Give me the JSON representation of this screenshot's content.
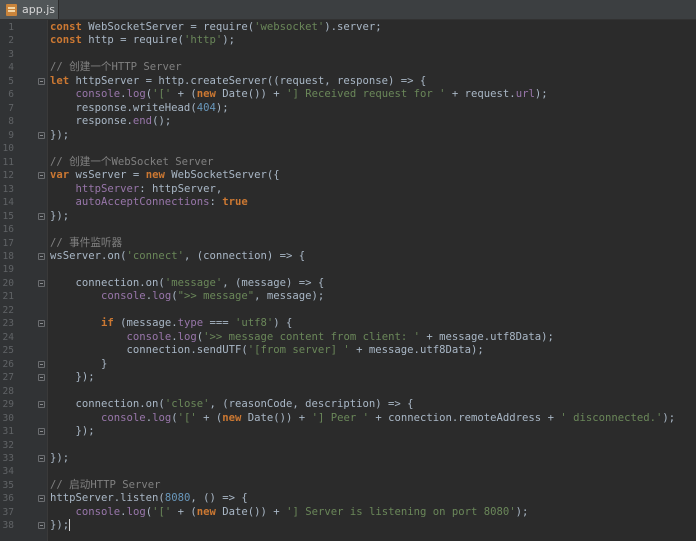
{
  "tab": {
    "label": "app.js",
    "icon": "js-file-icon"
  },
  "colors": {
    "background": "#2b2b2b",
    "keyword": "#cc7832",
    "string": "#6a8759",
    "number": "#6897bb",
    "property": "#9876aa",
    "comment": "#808080",
    "default": "#a9b7c6"
  },
  "code": {
    "lines": [
      {
        "n": "1",
        "tokens": [
          [
            "kw",
            "const"
          ],
          [
            "def",
            " WebSocketServer = require("
          ],
          [
            "str",
            "'websocket'"
          ],
          [
            "def",
            ").server;"
          ]
        ]
      },
      {
        "n": "2",
        "tokens": [
          [
            "kw",
            "const"
          ],
          [
            "def",
            " http = require("
          ],
          [
            "str",
            "'http'"
          ],
          [
            "def",
            ");"
          ]
        ]
      },
      {
        "n": "3",
        "tokens": []
      },
      {
        "n": "4",
        "tokens": [
          [
            "com",
            "// 创建一个HTTP Server"
          ]
        ]
      },
      {
        "n": "5",
        "fold": true,
        "tokens": [
          [
            "kw",
            "let"
          ],
          [
            "def",
            " httpServer = http.createServer((request, response) => {"
          ]
        ]
      },
      {
        "n": "6",
        "tokens": [
          [
            "def",
            "    "
          ],
          [
            "prop",
            "console"
          ],
          [
            "def",
            "."
          ],
          [
            "prop",
            "log"
          ],
          [
            "def",
            "("
          ],
          [
            "str",
            "'['"
          ],
          [
            "def",
            " + ("
          ],
          [
            "kw",
            "new"
          ],
          [
            "def",
            " Date()) + "
          ],
          [
            "str",
            "'] Received request for '"
          ],
          [
            "def",
            " + request."
          ],
          [
            "prop",
            "url"
          ],
          [
            "def",
            ");"
          ]
        ]
      },
      {
        "n": "7",
        "tokens": [
          [
            "def",
            "    response.writeHead("
          ],
          [
            "num",
            "404"
          ],
          [
            "def",
            ");"
          ]
        ]
      },
      {
        "n": "8",
        "tokens": [
          [
            "def",
            "    response."
          ],
          [
            "prop",
            "end"
          ],
          [
            "def",
            "();"
          ]
        ]
      },
      {
        "n": "9",
        "fold": true,
        "tokens": [
          [
            "def",
            "});"
          ]
        ]
      },
      {
        "n": "10",
        "tokens": []
      },
      {
        "n": "11",
        "tokens": [
          [
            "com",
            "// 创建一个WebSocket Server"
          ]
        ]
      },
      {
        "n": "12",
        "fold": true,
        "tokens": [
          [
            "kw",
            "var"
          ],
          [
            "def",
            " wsServer = "
          ],
          [
            "kw",
            "new"
          ],
          [
            "def",
            " WebSocketServer({"
          ]
        ]
      },
      {
        "n": "13",
        "tokens": [
          [
            "def",
            "    "
          ],
          [
            "prop",
            "httpServer"
          ],
          [
            "def",
            ": httpServer,"
          ]
        ]
      },
      {
        "n": "14",
        "tokens": [
          [
            "def",
            "    "
          ],
          [
            "prop",
            "autoAcceptConnections"
          ],
          [
            "def",
            ": "
          ],
          [
            "kw",
            "true"
          ]
        ]
      },
      {
        "n": "15",
        "fold": true,
        "tokens": [
          [
            "def",
            "});"
          ]
        ]
      },
      {
        "n": "16",
        "tokens": []
      },
      {
        "n": "17",
        "tokens": [
          [
            "com",
            "// 事件监听器"
          ]
        ]
      },
      {
        "n": "18",
        "fold": true,
        "tokens": [
          [
            "def",
            "wsServer.on("
          ],
          [
            "str",
            "'connect'"
          ],
          [
            "def",
            ", (connection) => {"
          ]
        ]
      },
      {
        "n": "19",
        "tokens": []
      },
      {
        "n": "20",
        "fold": true,
        "tokens": [
          [
            "def",
            "    connection.on("
          ],
          [
            "str",
            "'message'"
          ],
          [
            "def",
            ", (message) => {"
          ]
        ]
      },
      {
        "n": "21",
        "tokens": [
          [
            "def",
            "        "
          ],
          [
            "prop",
            "console"
          ],
          [
            "def",
            "."
          ],
          [
            "prop",
            "log"
          ],
          [
            "def",
            "("
          ],
          [
            "str",
            "\">> message\""
          ],
          [
            "def",
            ", message);"
          ]
        ]
      },
      {
        "n": "22",
        "tokens": []
      },
      {
        "n": "23",
        "fold": true,
        "tokens": [
          [
            "def",
            "        "
          ],
          [
            "kw",
            "if"
          ],
          [
            "def",
            " (message."
          ],
          [
            "prop",
            "type"
          ],
          [
            "def",
            " === "
          ],
          [
            "str",
            "'utf8'"
          ],
          [
            "def",
            ") {"
          ]
        ]
      },
      {
        "n": "24",
        "tokens": [
          [
            "def",
            "            "
          ],
          [
            "prop",
            "console"
          ],
          [
            "def",
            "."
          ],
          [
            "prop",
            "log"
          ],
          [
            "def",
            "("
          ],
          [
            "str",
            "'>> message content from client: '"
          ],
          [
            "def",
            " + message.utf8Data);"
          ]
        ]
      },
      {
        "n": "25",
        "tokens": [
          [
            "def",
            "            connection.sendUTF("
          ],
          [
            "str",
            "'[from server] '"
          ],
          [
            "def",
            " + message.utf8Data);"
          ]
        ]
      },
      {
        "n": "26",
        "fold": true,
        "tokens": [
          [
            "def",
            "        }"
          ]
        ]
      },
      {
        "n": "27",
        "fold": true,
        "tokens": [
          [
            "def",
            "    });"
          ]
        ]
      },
      {
        "n": "28",
        "tokens": []
      },
      {
        "n": "29",
        "fold": true,
        "tokens": [
          [
            "def",
            "    connection.on("
          ],
          [
            "str",
            "'close'"
          ],
          [
            "def",
            ", (reasonCode, description) => {"
          ]
        ]
      },
      {
        "n": "30",
        "tokens": [
          [
            "def",
            "        "
          ],
          [
            "prop",
            "console"
          ],
          [
            "def",
            "."
          ],
          [
            "prop",
            "log"
          ],
          [
            "def",
            "("
          ],
          [
            "str",
            "'['"
          ],
          [
            "def",
            " + ("
          ],
          [
            "kw",
            "new"
          ],
          [
            "def",
            " Date()) + "
          ],
          [
            "str",
            "'] Peer '"
          ],
          [
            "def",
            " + connection.remoteAddress + "
          ],
          [
            "str",
            "' disconnected.'"
          ],
          [
            "def",
            ");"
          ]
        ]
      },
      {
        "n": "31",
        "fold": true,
        "tokens": [
          [
            "def",
            "    });"
          ]
        ]
      },
      {
        "n": "32",
        "tokens": []
      },
      {
        "n": "33",
        "fold": true,
        "tokens": [
          [
            "def",
            "});"
          ]
        ]
      },
      {
        "n": "34",
        "tokens": []
      },
      {
        "n": "35",
        "tokens": [
          [
            "com",
            "// 启动HTTP Server"
          ]
        ]
      },
      {
        "n": "36",
        "fold": true,
        "tokens": [
          [
            "def",
            "httpServer.listen("
          ],
          [
            "num",
            "8080"
          ],
          [
            "def",
            ", () => {"
          ]
        ]
      },
      {
        "n": "37",
        "tokens": [
          [
            "def",
            "    "
          ],
          [
            "prop",
            "console"
          ],
          [
            "def",
            "."
          ],
          [
            "prop",
            "log"
          ],
          [
            "def",
            "("
          ],
          [
            "str",
            "'['"
          ],
          [
            "def",
            " + ("
          ],
          [
            "kw",
            "new"
          ],
          [
            "def",
            " Date()) + "
          ],
          [
            "str",
            "'] Server is listening on port 8080'"
          ],
          [
            "def",
            ");"
          ]
        ]
      },
      {
        "n": "38",
        "fold": true,
        "cursor": true,
        "tokens": [
          [
            "def",
            "});"
          ]
        ]
      }
    ]
  }
}
